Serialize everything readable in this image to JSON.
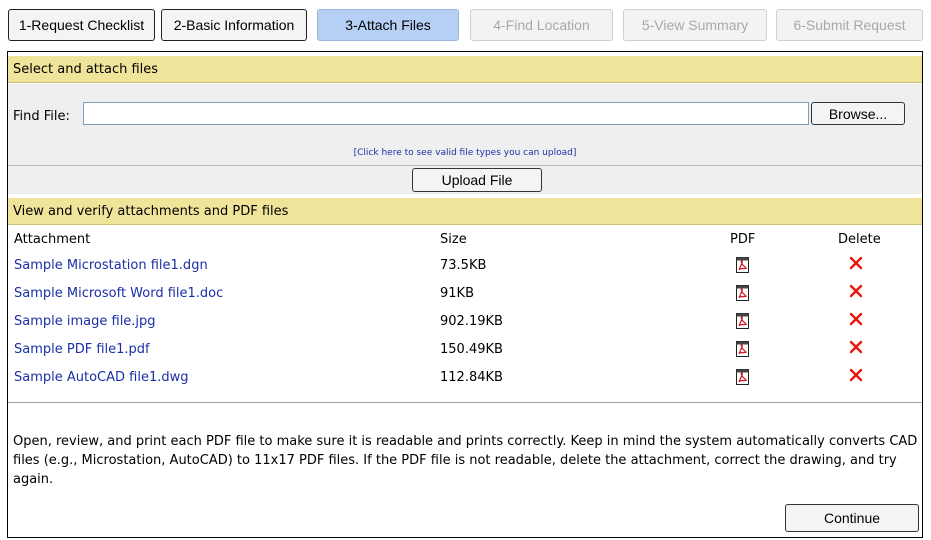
{
  "tabs": [
    {
      "label": "1-Request Checklist",
      "state": "done"
    },
    {
      "label": "2-Basic Information",
      "state": "done"
    },
    {
      "label": "3-Attach Files",
      "state": "active"
    },
    {
      "label": "4-Find Location",
      "state": "disabled"
    },
    {
      "label": "5-View Summary",
      "state": "disabled"
    },
    {
      "label": "6-Submit Request",
      "state": "disabled"
    }
  ],
  "attach_section": {
    "title": "Select and attach files",
    "find_label": "Find File:",
    "find_value": "",
    "browse_label": "Browse...",
    "valid_types_link": "[Click here to see valid file types you can upload]",
    "upload_label": "Upload File"
  },
  "verify_section": {
    "title": "View and verify attachments and PDF files",
    "columns": {
      "attachment": "Attachment",
      "size": "Size",
      "pdf": "PDF",
      "delete": "Delete"
    },
    "rows": [
      {
        "name": "Sample Microstation file1.dgn",
        "size": "73.5KB"
      },
      {
        "name": "Sample Microsoft Word file1.doc",
        "size": "91KB"
      },
      {
        "name": "Sample image file.jpg",
        "size": "902.19KB"
      },
      {
        "name": "Sample PDF file1.pdf",
        "size": "150.49KB"
      },
      {
        "name": "Sample AutoCAD file1.dwg",
        "size": "112.84KB"
      }
    ]
  },
  "notice": "Open, review, and print each PDF file to make sure it is readable and prints correctly. Keep in mind the system automatically converts CAD files (e.g., Microstation, AutoCAD) to 11x17 PDF files. If the PDF file is not readable, delete the attachment, correct the drawing, and try again.",
  "continue_label": "Continue",
  "icons": {
    "pdf": "pdf-file-icon",
    "delete": "red-x-delete-icon"
  },
  "colors": {
    "header_bg": "#f0e49b",
    "active_tab": "#b6cff5",
    "link": "#1b2fa6",
    "delete": "#e8160c"
  }
}
